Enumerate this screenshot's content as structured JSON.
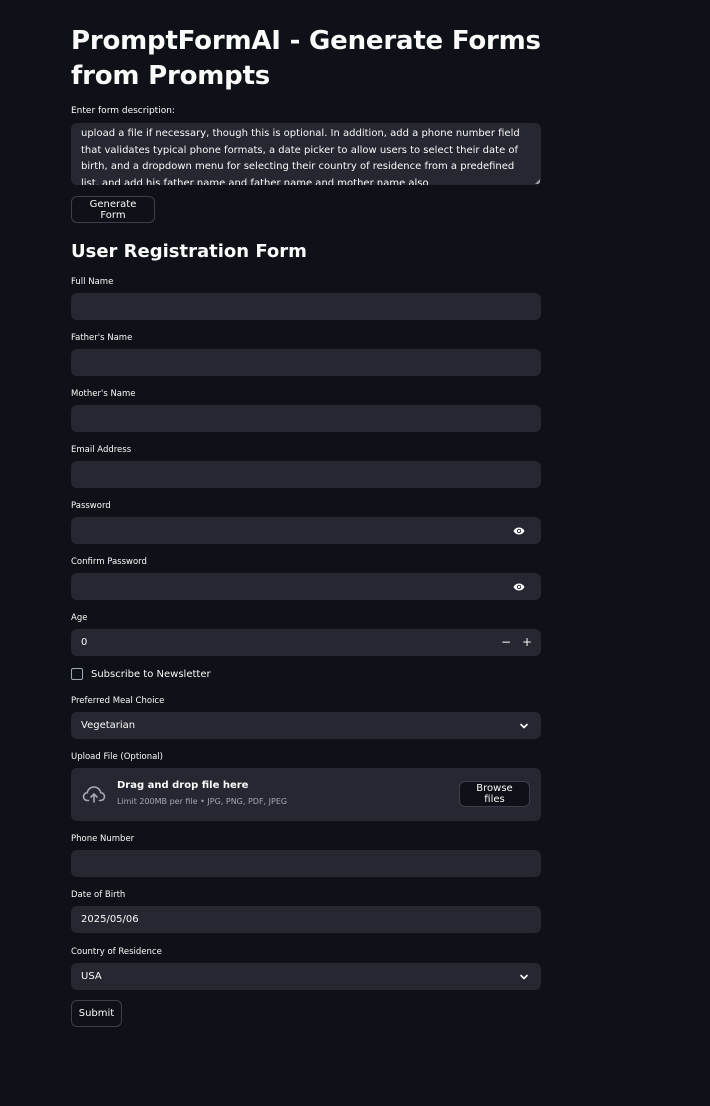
{
  "app": {
    "title": "PromptFormAI - Generate Forms from Prompts"
  },
  "prompt": {
    "label": "Enter form description:",
    "value": "upload a file if necessary, though this is optional. In addition, add a phone number field that validates typical phone formats, a date picker to allow users to select their date of birth, and a dropdown menu for selecting their country of residence from a predefined list. and add his father name and father name and mother name also",
    "generate_label": "Generate Form"
  },
  "form": {
    "title": "User Registration Form",
    "full_name": {
      "label": "Full Name",
      "value": ""
    },
    "father_name": {
      "label": "Father's Name",
      "value": ""
    },
    "mother_name": {
      "label": "Mother's Name",
      "value": ""
    },
    "email": {
      "label": "Email Address",
      "value": ""
    },
    "password": {
      "label": "Password",
      "value": "",
      "icon": "eye-icon"
    },
    "confirm_password": {
      "label": "Confirm Password",
      "value": "",
      "icon": "eye-icon"
    },
    "age": {
      "label": "Age",
      "value": "0",
      "minus": "−",
      "plus": "+"
    },
    "newsletter": {
      "label": "Subscribe to Newsletter",
      "checked": false
    },
    "meal": {
      "label": "Preferred Meal Choice",
      "selected": "Vegetarian"
    },
    "upload": {
      "label": "Upload File (Optional)",
      "drop_title": "Drag and drop file here",
      "drop_sub": "Limit 200MB per file • JPG, PNG, PDF, JPEG",
      "browse_label": "Browse files",
      "icon": "cloud-upload-icon"
    },
    "phone": {
      "label": "Phone Number",
      "value": ""
    },
    "dob": {
      "label": "Date of Birth",
      "value": "2025/05/06"
    },
    "country": {
      "label": "Country of Residence",
      "selected": "USA"
    },
    "submit_label": "Submit"
  },
  "colors": {
    "background": "#0e1117",
    "input_bg": "#262730",
    "text": "#fafafa",
    "muted": "#a3a8b4",
    "border": "#3d404a"
  }
}
